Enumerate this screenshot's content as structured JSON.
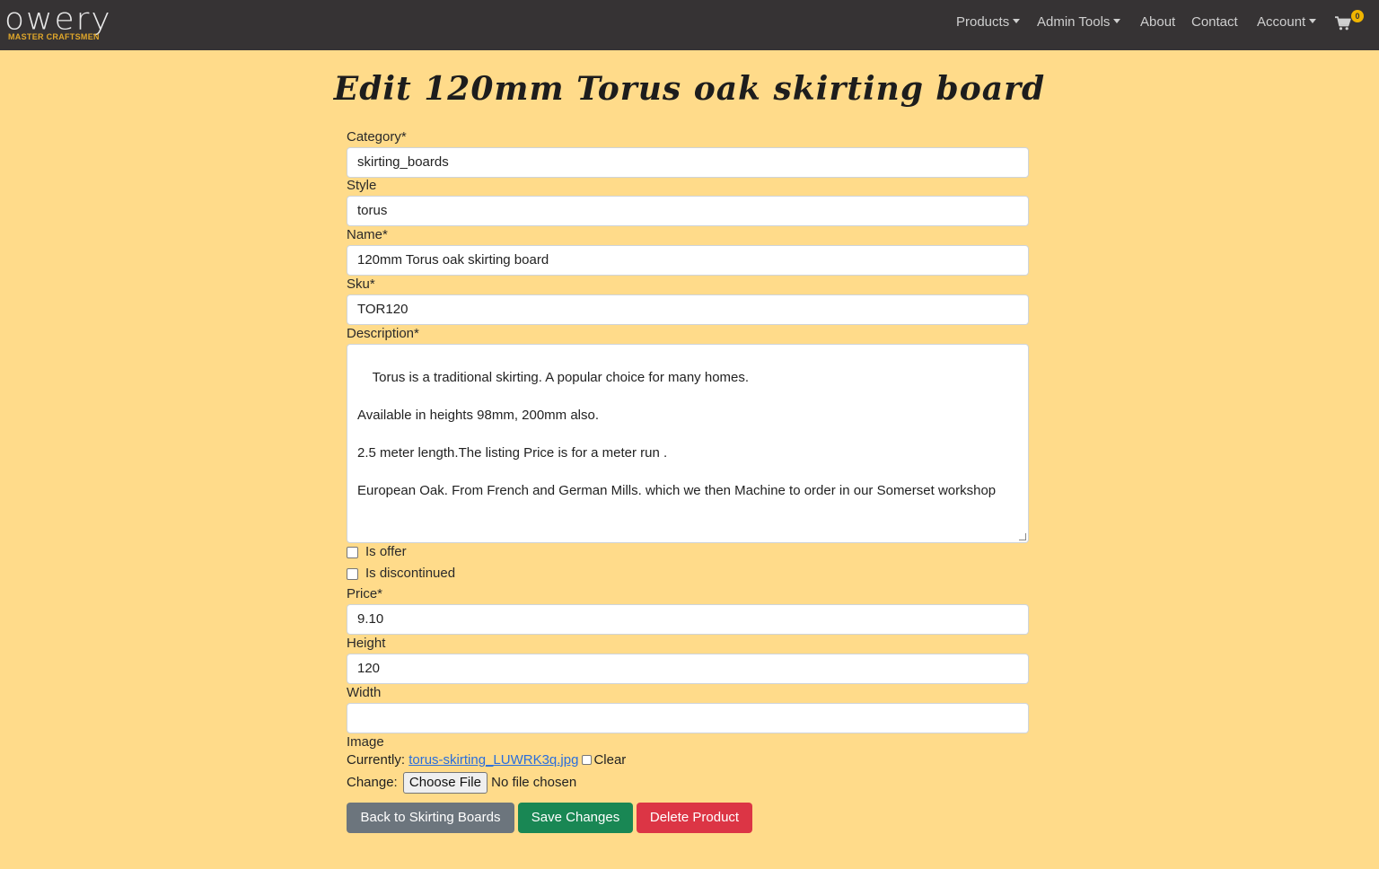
{
  "navbar": {
    "logo_word": "owery",
    "logo_sub": "MASTER CRAFTSMEN",
    "items": [
      "Products",
      "Admin Tools",
      "About",
      "Contact",
      "Account"
    ],
    "cart_count": "0"
  },
  "page": {
    "title": "Edit 120mm Torus oak skirting board"
  },
  "form": {
    "category_label": "Category*",
    "category_value": "skirting_boards",
    "style_label": "Style",
    "style_value": "torus",
    "name_label": "Name*",
    "name_value": "120mm Torus oak skirting board",
    "sku_label": "Sku*",
    "sku_value": "TOR120",
    "description_label": "Description*",
    "description_value": "Torus is a traditional skirting. A popular choice for many homes.\n\nAvailable in heights 98mm, 200mm also.\n\n2.5 meter length.The listing Price is for a meter run .\n\nEuropean Oak. From French and German Mills. which we then Machine to order in our Somerset workshop",
    "is_offer_label": "Is offer",
    "is_discontinued_label": "Is discontinued",
    "price_label": "Price*",
    "price_value": "9.10",
    "height_label": "Height",
    "height_value": "120",
    "width_label": "Width",
    "width_value": "",
    "image_label": "Image",
    "currently_label": "Currently:",
    "current_file": "torus-skirting_LUWRK3q.jpg",
    "clear_label": "Clear",
    "change_label": "Change:",
    "choose_file_label": "Choose File",
    "no_file_label": "No file chosen"
  },
  "buttons": {
    "back": "Back to Skirting Boards",
    "save": "Save Changes",
    "delete": "Delete Product"
  }
}
